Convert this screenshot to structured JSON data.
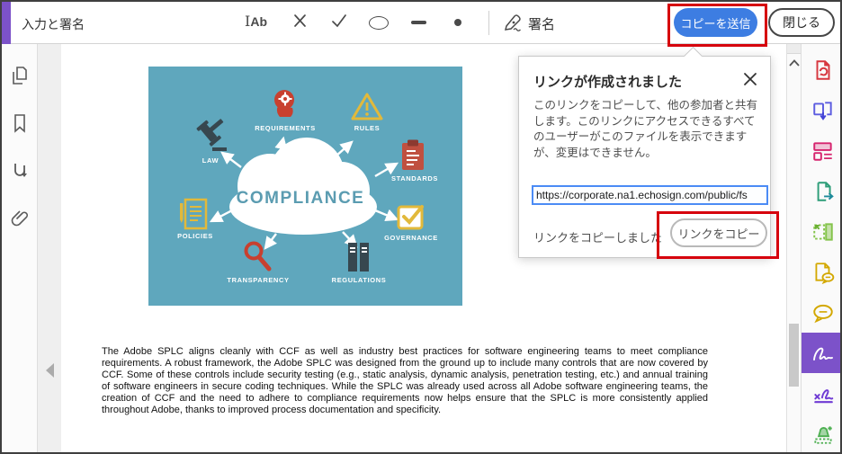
{
  "colors": {
    "accent_purple": "#7c52c9",
    "primary_blue": "#3d7de2",
    "annotation_red": "#d6000c",
    "link_border_blue": "#4b8bf5",
    "diagram_teal": "#5fa7bd"
  },
  "toolbar": {
    "title": "入力と署名",
    "text_tool_label": "Ab",
    "sign_label": "署名",
    "send_copy_button": "コピーを送信",
    "close_button": "閉じる",
    "icons": [
      "text-insert-icon",
      "cross-mark-icon",
      "check-mark-icon",
      "circle-icon",
      "dash-icon",
      "dot-icon",
      "pen-nib-icon"
    ]
  },
  "left_sidebar": {
    "icons": [
      "page-thumbnails-icon",
      "bookmarks-icon",
      "page-jump-icon",
      "attachments-icon"
    ]
  },
  "right_sidebar": {
    "selected_tool": "fill-and-sign",
    "tools": [
      "create-pdf-icon",
      "combine-files-icon",
      "edit-pdf-icon",
      "export-pdf-icon",
      "organize-pages-icon",
      "send-for-comments-icon",
      "comment-icon",
      "fill-and-sign-icon",
      "request-signatures-icon",
      "stamp-icon"
    ]
  },
  "popup": {
    "title": "リンクが作成されました",
    "body": "このリンクをコピーして、他の参加者と共有します。このリンクにアクセスできるすべてのユーザーがこのファイルを表示できますが、変更はできません。",
    "link_value": "https://corporate.na1.echosign.com/public/fs",
    "copied_status": "リンクをコピーしました",
    "copy_button": "リンクをコピー"
  },
  "document": {
    "paragraph": "The Adobe SPLC aligns cleanly with CCF as well as industry best practices for software engineering teams to meet compliance requirements. A robust framework, the Adobe SPLC was designed from the ground up to include many controls that are now covered by CCF. Some of these controls include security testing (e.g., static analysis, dynamic analysis, penetration testing, etc.) and annual training of software engineers in secure coding techniques. While the SPLC was already used across all Adobe software engineering teams, the creation of CCF and the need to adhere to compliance requirements now helps ensure that the SPLC is more consistently applied throughout Adobe, thanks to improved process documentation and specificity."
  },
  "diagram": {
    "center_label": "COMPLIANCE",
    "nodes": [
      {
        "label": "LAW",
        "icon": "gavel-icon"
      },
      {
        "label": "REQUIREMENTS",
        "icon": "head-gears-icon"
      },
      {
        "label": "RULES",
        "icon": "warning-triangle-icon"
      },
      {
        "label": "STANDARDS",
        "icon": "clipboard-icon"
      },
      {
        "label": "GOVERNANCE",
        "icon": "checkbox-icon"
      },
      {
        "label": "REGULATIONS",
        "icon": "binders-icon"
      },
      {
        "label": "TRANSPARENCY",
        "icon": "magnifier-icon"
      },
      {
        "label": "POLICIES",
        "icon": "document-icon"
      }
    ]
  }
}
